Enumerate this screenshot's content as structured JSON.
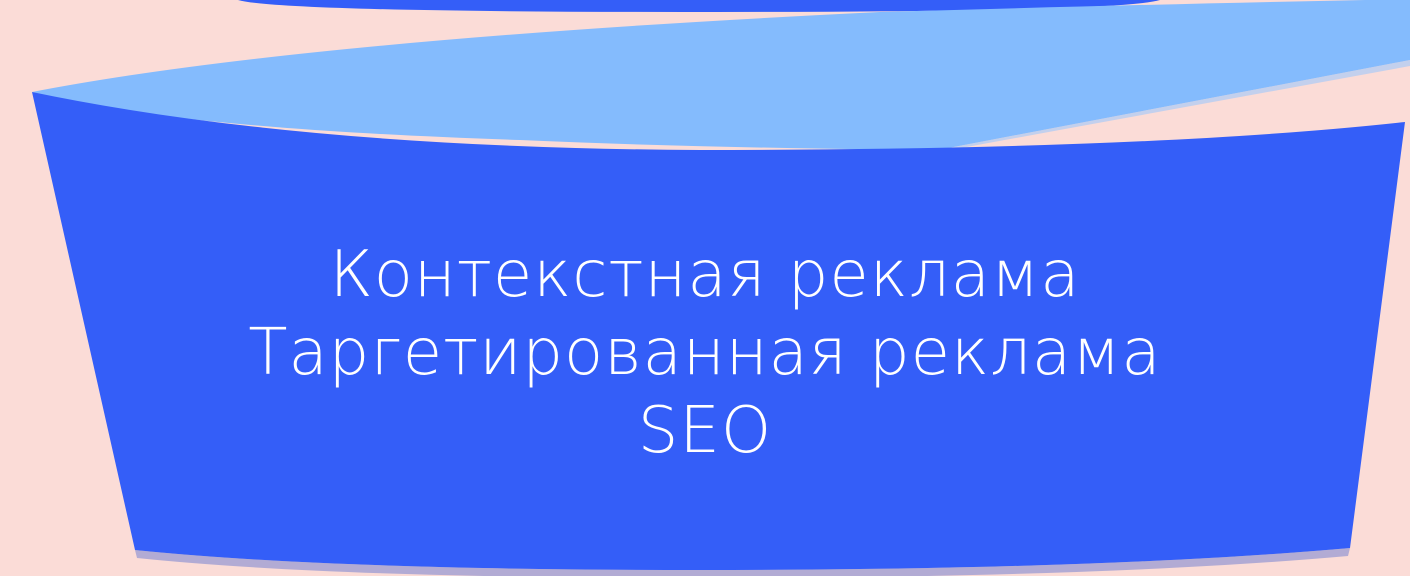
{
  "funnel": {
    "colors": {
      "background": "#fbdcd7",
      "tier_main": "#345ef8",
      "ribbon": "#84bbfd",
      "edge_shadow": "#2b4fcf"
    },
    "tier_labels": [
      "Контекстная реклама",
      "Таргетированная реклама",
      "SEO"
    ]
  }
}
